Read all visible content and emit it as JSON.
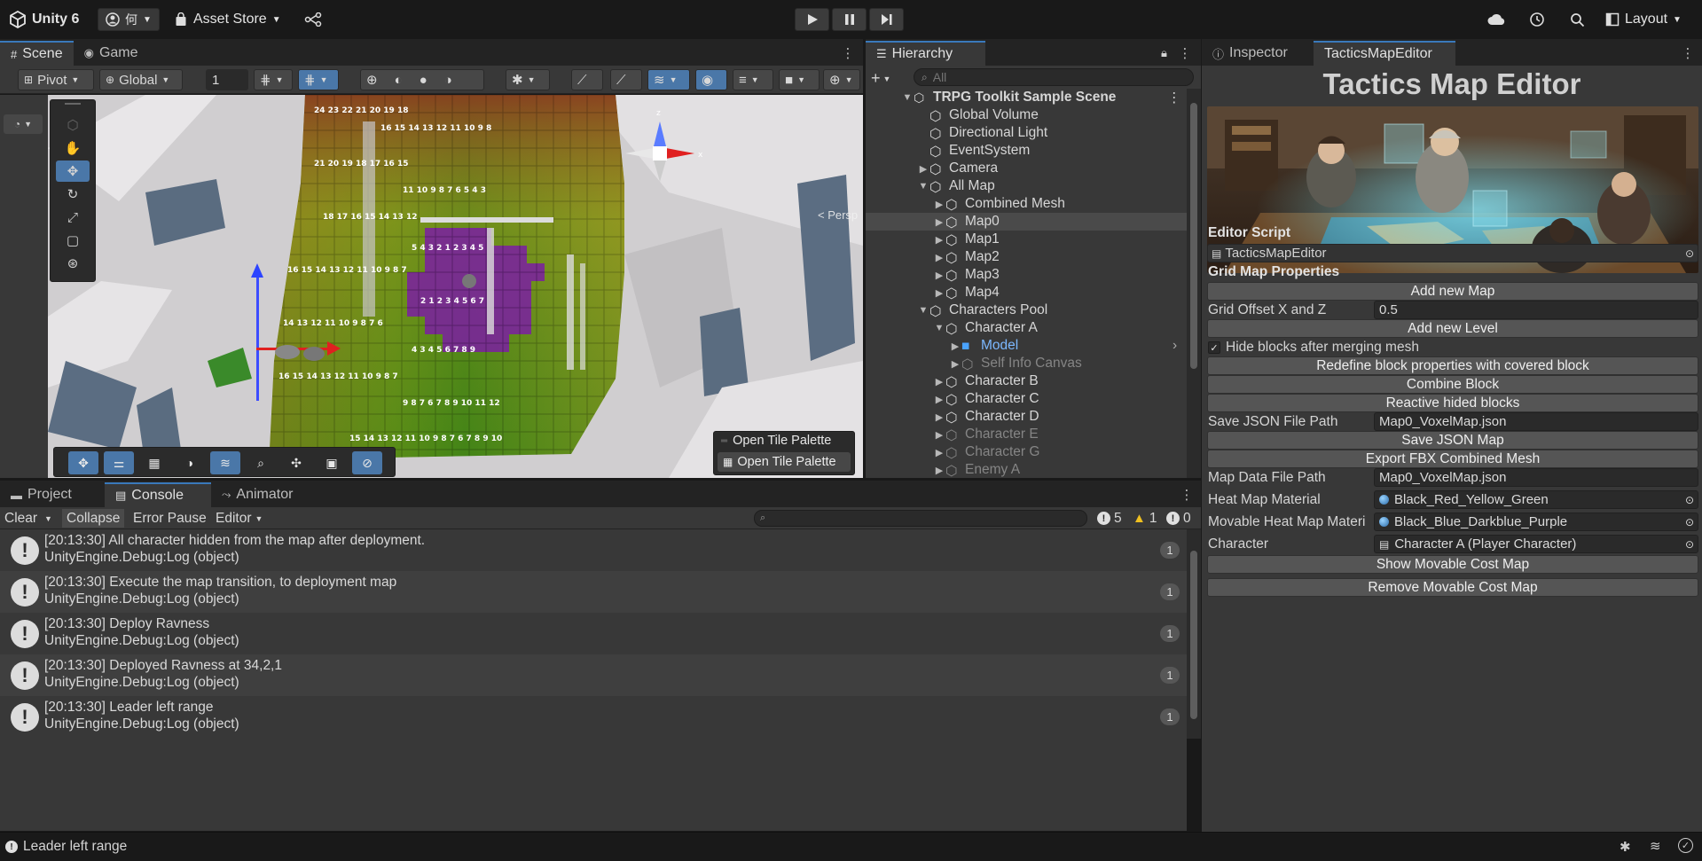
{
  "topbar": {
    "app_name": "Unity 6",
    "account_label": "何",
    "asset_store_label": "Asset Store",
    "layout_label": "Layout"
  },
  "scene_panel": {
    "tabs": [
      {
        "label": "Scene"
      },
      {
        "label": "Game"
      }
    ],
    "pivot_label": "Pivot",
    "global_label": "Global",
    "grid_snap_value": "1",
    "persp_label": "< Persp",
    "open_tile_palette_header": "Open Tile Palette",
    "open_tile_palette_button": "Open Tile Palette"
  },
  "hierarchy": {
    "tab_label": "Hierarchy",
    "search_placeholder": "All",
    "scene_name": "TRPG Toolkit Sample Scene",
    "items": [
      {
        "label": "Global Volume"
      },
      {
        "label": "Directional Light"
      },
      {
        "label": "EventSystem"
      },
      {
        "label": "Camera"
      },
      {
        "label": "All Map"
      },
      {
        "label": "Combined Mesh"
      },
      {
        "label": "Map0"
      },
      {
        "label": "Map1"
      },
      {
        "label": "Map2"
      },
      {
        "label": "Map3"
      },
      {
        "label": "Map4"
      },
      {
        "label": "Characters Pool"
      },
      {
        "label": "Character A"
      },
      {
        "label": "Model"
      },
      {
        "label": "Self Info Canvas"
      },
      {
        "label": "Character B"
      },
      {
        "label": "Character C"
      },
      {
        "label": "Character D"
      },
      {
        "label": "Character E"
      },
      {
        "label": "Character G"
      },
      {
        "label": "Enemy A"
      }
    ]
  },
  "inspector": {
    "tabs": [
      {
        "label": "Inspector"
      },
      {
        "label": "TacticsMapEditor"
      }
    ],
    "title": "Tactics Map Editor",
    "editor_script_header": "Editor Script",
    "editor_script_value": "TacticsMapEditor",
    "grid_header": "Grid Map Properties",
    "add_new_map": "Add new Map",
    "grid_offset_label": "Grid Offset X and Z",
    "grid_offset_value": "0.5",
    "add_new_level": "Add new Level",
    "hide_blocks_label": "Hide blocks after merging mesh",
    "hide_blocks_checked": true,
    "redefine_blocks": "Redefine block properties with covered block",
    "combine_block": "Combine Block",
    "reactive_blocks": "Reactive hided blocks",
    "save_json_path_label": "Save JSON File Path",
    "save_json_path_value": "Map0_VoxelMap.json",
    "save_json_map": "Save JSON Map",
    "export_fbx": "Export FBX Combined Mesh",
    "map_data_path_label": "Map Data File Path",
    "map_data_path_value": "Map0_VoxelMap.json",
    "heat_map_label": "Heat Map Material",
    "heat_map_value": "Black_Red_Yellow_Green",
    "movable_heat_label": "Movable Heat Map Materi",
    "movable_heat_value": "Black_Blue_Darkblue_Purple",
    "character_label": "Character",
    "character_value": "Character A (Player Character)",
    "show_cost_map": "Show Movable Cost Map",
    "remove_cost_map": "Remove Movable Cost Map"
  },
  "bottom_panel": {
    "tabs": [
      {
        "label": "Project"
      },
      {
        "label": "Console"
      },
      {
        "label": "Animator"
      }
    ],
    "clear_label": "Clear",
    "collapse_label": "Collapse",
    "error_pause_label": "Error Pause",
    "editor_label": "Editor",
    "log_count": "5",
    "warning_count": "1",
    "error_count": "0",
    "logs": [
      {
        "line1": "[20:13:30] All character hidden from the map after deployment.",
        "line2": "UnityEngine.Debug:Log (object)",
        "count": "1"
      },
      {
        "line1": "[20:13:30] Execute the map transition, to deployment map",
        "line2": "UnityEngine.Debug:Log (object)",
        "count": "1"
      },
      {
        "line1": "[20:13:30] Deploy Ravness",
        "line2": "UnityEngine.Debug:Log (object)",
        "count": "1"
      },
      {
        "line1": "[20:13:30] Deployed Ravness at 34,2,1",
        "line2": "UnityEngine.Debug:Log (object)",
        "count": "1"
      },
      {
        "line1": "[20:13:30] Leader left range",
        "line2": "UnityEngine.Debug:Log (object)",
        "count": "1"
      }
    ]
  },
  "status_bar": {
    "message": "Leader left range"
  },
  "colors": {
    "accent": "#3a79bb",
    "selection": "#4a77a8",
    "panel": "#383838",
    "background": "#191919"
  },
  "icons": [
    "unity-logo-icon",
    "account-icon",
    "shopping-bag-icon",
    "version-control-icon",
    "play-icon",
    "pause-icon",
    "step-icon",
    "cloud-icon",
    "history-icon",
    "search-icon",
    "layout-icon",
    "info-icon",
    "warning-icon",
    "error-icon",
    "bug-icon",
    "check-icon"
  ]
}
